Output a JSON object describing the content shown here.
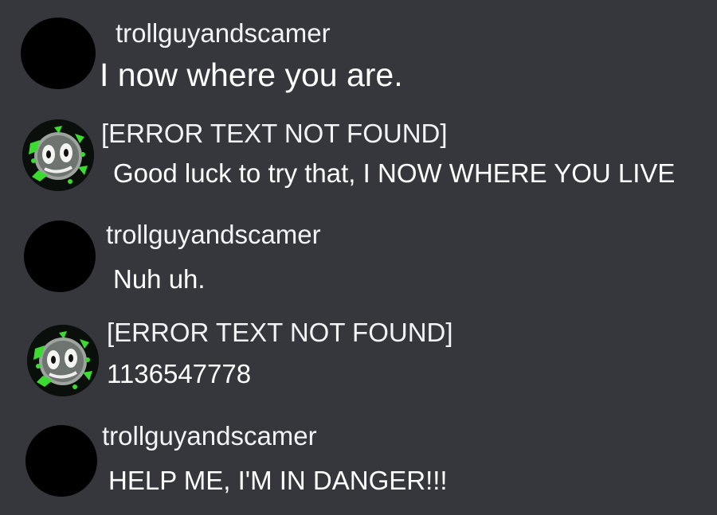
{
  "messages": [
    {
      "author": "trollguyandscamer",
      "avatar_icon": "blacked-out-avatar-icon",
      "text": "I now where you are."
    },
    {
      "author": "[ERROR TEXT NOT FOUND]",
      "avatar_icon": "glitched-skull-avatar-icon",
      "text": "Good luck to try that, I NOW WHERE YOU LIVE"
    },
    {
      "author": "trollguyandscamer",
      "avatar_icon": "blacked-out-avatar-icon",
      "text": "Nuh uh."
    },
    {
      "author": "[ERROR TEXT NOT FOUND]",
      "avatar_icon": "glitched-skull-avatar-icon",
      "text": "1136547778"
    },
    {
      "author": "trollguyandscamer",
      "avatar_icon": "blacked-out-avatar-icon",
      "text": "HELP ME, I'M IN DANGER!!!"
    }
  ],
  "colors": {
    "background": "#36373d",
    "username": "#f2f3f5",
    "message_text": "#ffffff",
    "avatar_dark": "#000000",
    "glitch_green": "#3bdc2f"
  }
}
